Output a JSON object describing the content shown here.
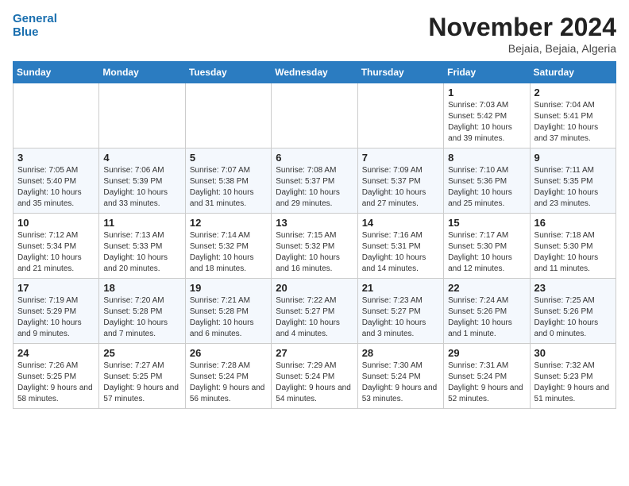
{
  "header": {
    "logo_line1": "General",
    "logo_line2": "Blue",
    "month": "November 2024",
    "location": "Bejaia, Bejaia, Algeria"
  },
  "weekdays": [
    "Sunday",
    "Monday",
    "Tuesday",
    "Wednesday",
    "Thursday",
    "Friday",
    "Saturday"
  ],
  "weeks": [
    [
      {
        "day": "",
        "info": ""
      },
      {
        "day": "",
        "info": ""
      },
      {
        "day": "",
        "info": ""
      },
      {
        "day": "",
        "info": ""
      },
      {
        "day": "",
        "info": ""
      },
      {
        "day": "1",
        "info": "Sunrise: 7:03 AM\nSunset: 5:42 PM\nDaylight: 10 hours and 39 minutes."
      },
      {
        "day": "2",
        "info": "Sunrise: 7:04 AM\nSunset: 5:41 PM\nDaylight: 10 hours and 37 minutes."
      }
    ],
    [
      {
        "day": "3",
        "info": "Sunrise: 7:05 AM\nSunset: 5:40 PM\nDaylight: 10 hours and 35 minutes."
      },
      {
        "day": "4",
        "info": "Sunrise: 7:06 AM\nSunset: 5:39 PM\nDaylight: 10 hours and 33 minutes."
      },
      {
        "day": "5",
        "info": "Sunrise: 7:07 AM\nSunset: 5:38 PM\nDaylight: 10 hours and 31 minutes."
      },
      {
        "day": "6",
        "info": "Sunrise: 7:08 AM\nSunset: 5:37 PM\nDaylight: 10 hours and 29 minutes."
      },
      {
        "day": "7",
        "info": "Sunrise: 7:09 AM\nSunset: 5:37 PM\nDaylight: 10 hours and 27 minutes."
      },
      {
        "day": "8",
        "info": "Sunrise: 7:10 AM\nSunset: 5:36 PM\nDaylight: 10 hours and 25 minutes."
      },
      {
        "day": "9",
        "info": "Sunrise: 7:11 AM\nSunset: 5:35 PM\nDaylight: 10 hours and 23 minutes."
      }
    ],
    [
      {
        "day": "10",
        "info": "Sunrise: 7:12 AM\nSunset: 5:34 PM\nDaylight: 10 hours and 21 minutes."
      },
      {
        "day": "11",
        "info": "Sunrise: 7:13 AM\nSunset: 5:33 PM\nDaylight: 10 hours and 20 minutes."
      },
      {
        "day": "12",
        "info": "Sunrise: 7:14 AM\nSunset: 5:32 PM\nDaylight: 10 hours and 18 minutes."
      },
      {
        "day": "13",
        "info": "Sunrise: 7:15 AM\nSunset: 5:32 PM\nDaylight: 10 hours and 16 minutes."
      },
      {
        "day": "14",
        "info": "Sunrise: 7:16 AM\nSunset: 5:31 PM\nDaylight: 10 hours and 14 minutes."
      },
      {
        "day": "15",
        "info": "Sunrise: 7:17 AM\nSunset: 5:30 PM\nDaylight: 10 hours and 12 minutes."
      },
      {
        "day": "16",
        "info": "Sunrise: 7:18 AM\nSunset: 5:30 PM\nDaylight: 10 hours and 11 minutes."
      }
    ],
    [
      {
        "day": "17",
        "info": "Sunrise: 7:19 AM\nSunset: 5:29 PM\nDaylight: 10 hours and 9 minutes."
      },
      {
        "day": "18",
        "info": "Sunrise: 7:20 AM\nSunset: 5:28 PM\nDaylight: 10 hours and 7 minutes."
      },
      {
        "day": "19",
        "info": "Sunrise: 7:21 AM\nSunset: 5:28 PM\nDaylight: 10 hours and 6 minutes."
      },
      {
        "day": "20",
        "info": "Sunrise: 7:22 AM\nSunset: 5:27 PM\nDaylight: 10 hours and 4 minutes."
      },
      {
        "day": "21",
        "info": "Sunrise: 7:23 AM\nSunset: 5:27 PM\nDaylight: 10 hours and 3 minutes."
      },
      {
        "day": "22",
        "info": "Sunrise: 7:24 AM\nSunset: 5:26 PM\nDaylight: 10 hours and 1 minute."
      },
      {
        "day": "23",
        "info": "Sunrise: 7:25 AM\nSunset: 5:26 PM\nDaylight: 10 hours and 0 minutes."
      }
    ],
    [
      {
        "day": "24",
        "info": "Sunrise: 7:26 AM\nSunset: 5:25 PM\nDaylight: 9 hours and 58 minutes."
      },
      {
        "day": "25",
        "info": "Sunrise: 7:27 AM\nSunset: 5:25 PM\nDaylight: 9 hours and 57 minutes."
      },
      {
        "day": "26",
        "info": "Sunrise: 7:28 AM\nSunset: 5:24 PM\nDaylight: 9 hours and 56 minutes."
      },
      {
        "day": "27",
        "info": "Sunrise: 7:29 AM\nSunset: 5:24 PM\nDaylight: 9 hours and 54 minutes."
      },
      {
        "day": "28",
        "info": "Sunrise: 7:30 AM\nSunset: 5:24 PM\nDaylight: 9 hours and 53 minutes."
      },
      {
        "day": "29",
        "info": "Sunrise: 7:31 AM\nSunset: 5:24 PM\nDaylight: 9 hours and 52 minutes."
      },
      {
        "day": "30",
        "info": "Sunrise: 7:32 AM\nSunset: 5:23 PM\nDaylight: 9 hours and 51 minutes."
      }
    ]
  ]
}
